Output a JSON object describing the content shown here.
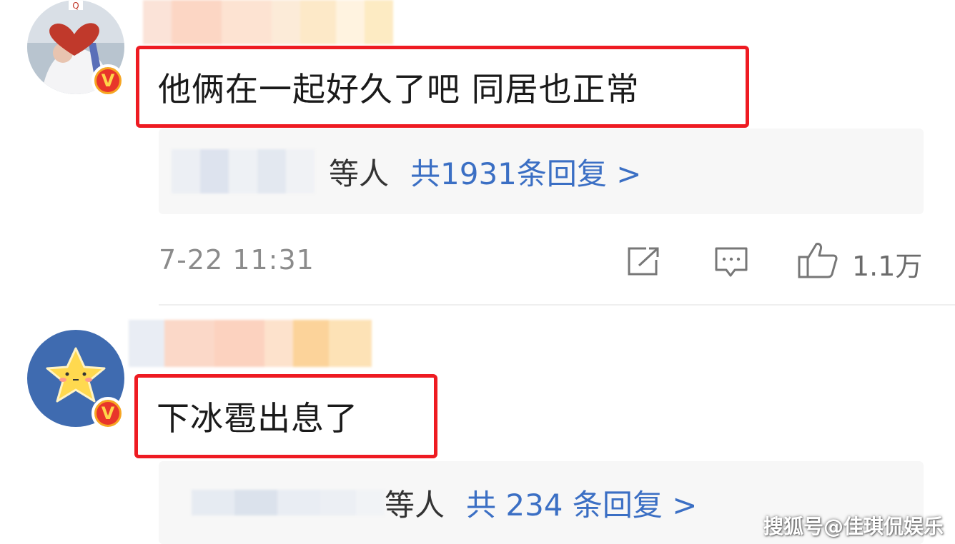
{
  "comments": [
    {
      "avatar": "girl-heart-avatar",
      "verified_badge": "V",
      "text": "他俩在一起好久了吧 同居也正常",
      "replies": {
        "users_suffix": "等人",
        "count_text": "共1931条回复 >"
      },
      "timestamp": "7-22 11:31",
      "actions": {
        "share_icon": "share-icon",
        "comment_icon": "comment-icon",
        "like_icon": "thumbs-up-icon",
        "likes": "1.1万"
      }
    },
    {
      "avatar": "star-avatar",
      "verified_badge": "V",
      "text": "下冰雹出息了",
      "replies": {
        "users_suffix": "等人",
        "count_text": "共 234 条回复 >"
      }
    }
  ],
  "watermark": "搜狐号@佳琪侃娱乐",
  "colors": {
    "highlight": "#ee1b22",
    "link": "#3b6fc4",
    "badge": "#f6a623"
  }
}
